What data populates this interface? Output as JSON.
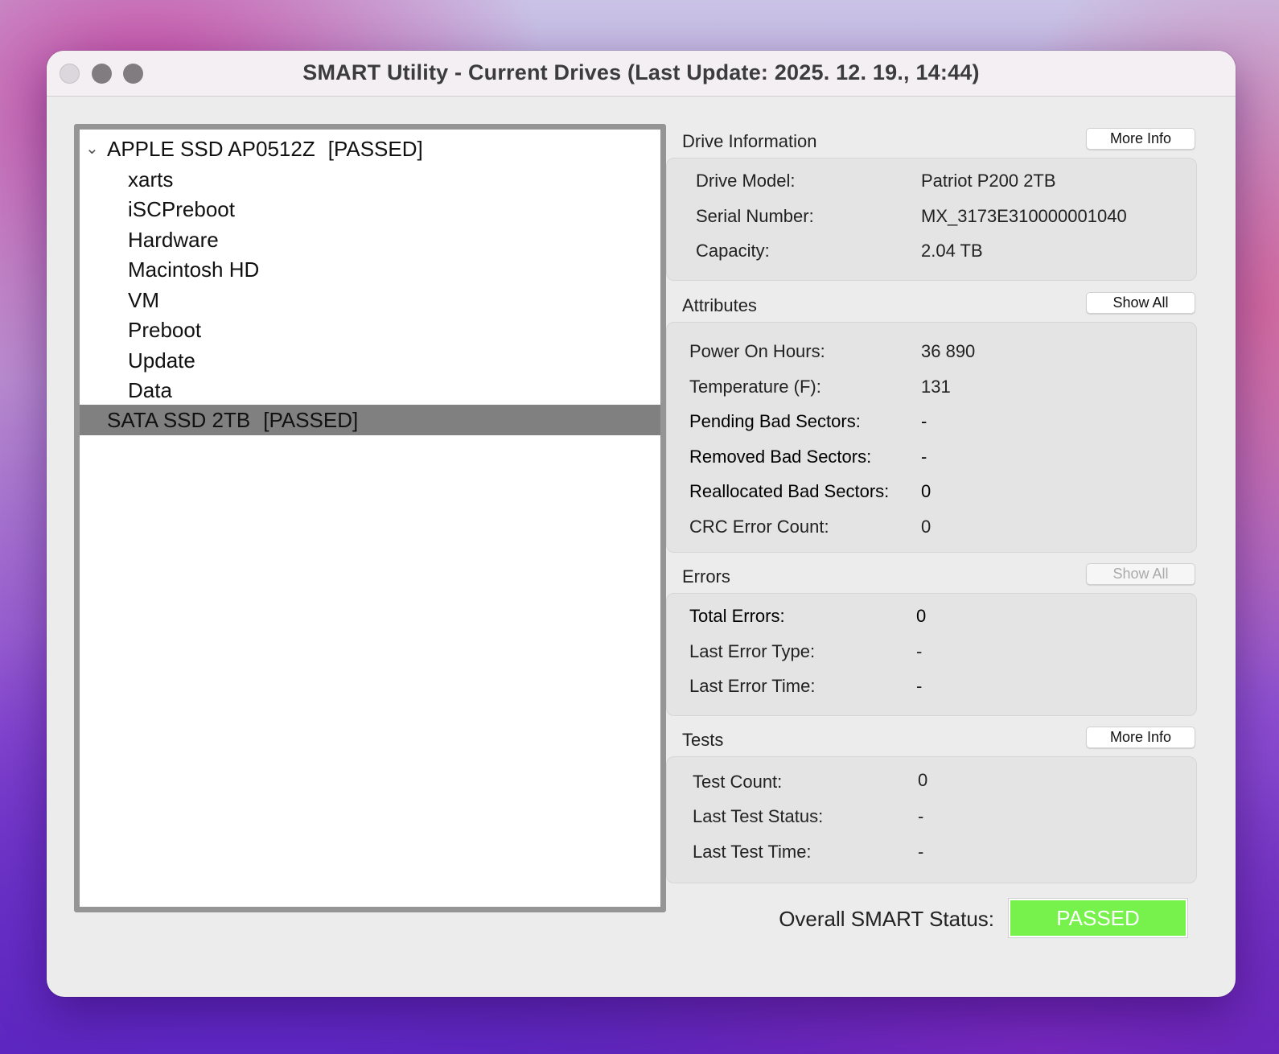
{
  "window": {
    "title": "SMART Utility - Current Drives (Last Update: 2025. 12. 19., 14:44)"
  },
  "tree": {
    "drives": [
      {
        "name": "APPLE SSD AP0512Z",
        "status": "[PASSED]",
        "expanded": true,
        "selected": false,
        "volumes": [
          "xarts",
          "iSCPreboot",
          "Hardware",
          "Macintosh HD",
          "VM",
          "Preboot",
          "Update",
          "Data"
        ]
      },
      {
        "name": "SATA SSD 2TB",
        "status": "[PASSED]",
        "expanded": false,
        "selected": true,
        "volumes": []
      }
    ]
  },
  "drive_info": {
    "title": "Drive Information",
    "button": "More Info",
    "rows": [
      {
        "label": "Drive Model:",
        "value": "Patriot P200 2TB"
      },
      {
        "label": "Serial Number:",
        "value": "MX_3173E310000001040"
      },
      {
        "label": "Capacity:",
        "value": "2.04 TB"
      }
    ]
  },
  "attributes": {
    "title": "Attributes",
    "button": "Show All",
    "rows": [
      {
        "label": "Power On Hours:",
        "value": "36 890"
      },
      {
        "label": "Temperature (F):",
        "value": "131"
      },
      {
        "label": "Pending Bad Sectors:",
        "value": "-"
      },
      {
        "label": "Removed Bad Sectors:",
        "value": "-"
      },
      {
        "label": "Reallocated Bad Sectors:",
        "value": "0"
      },
      {
        "label": "CRC Error Count:",
        "value": "0"
      }
    ]
  },
  "errors": {
    "title": "Errors",
    "button": "Show All",
    "button_enabled": false,
    "rows": [
      {
        "label": "Total Errors:",
        "value": "0"
      },
      {
        "label": "Last Error Type:",
        "value": "-"
      },
      {
        "label": "Last Error Time:",
        "value": "-"
      }
    ]
  },
  "tests": {
    "title": "Tests",
    "button": "More Info",
    "rows": [
      {
        "label": "Test Count:",
        "value": "0"
      },
      {
        "label": "Last Test Status:",
        "value": "-"
      },
      {
        "label": "Last Test Time:",
        "value": "-"
      }
    ]
  },
  "overall": {
    "label": "Overall SMART Status:",
    "status": "PASSED",
    "status_color": "#77f24c"
  },
  "colors": {
    "selection": "#808080",
    "window_bg": "#ececec"
  }
}
